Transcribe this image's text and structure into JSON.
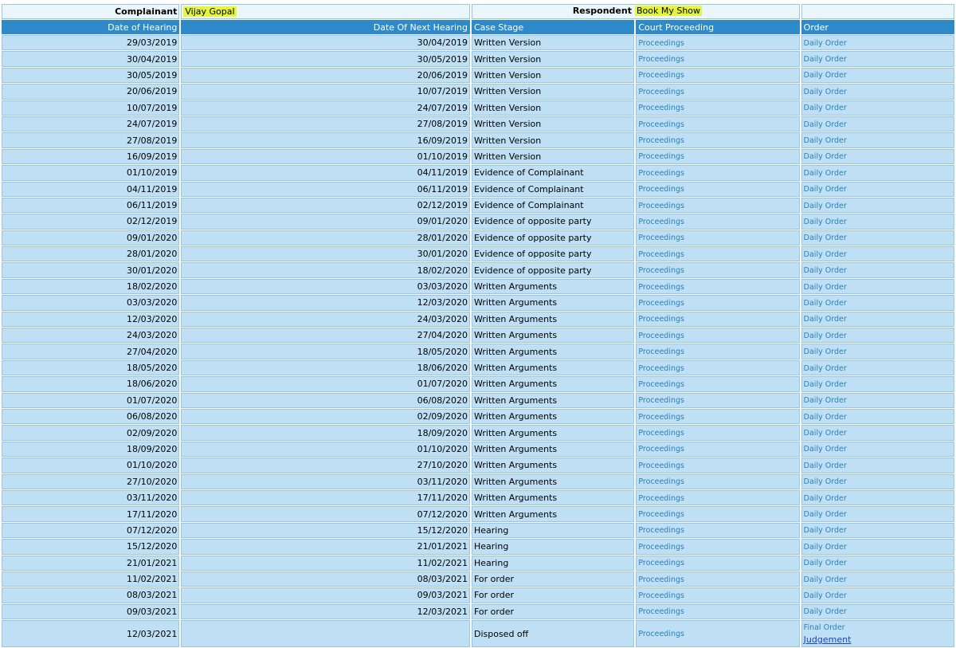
{
  "parties": {
    "complainant_label": "Complainant",
    "complainant_name": "Vijay Gopal",
    "respondent_label": "Respondent",
    "respondent_name": "Book My Show"
  },
  "columns": {
    "date_of_hearing": "Date of Hearing",
    "date_of_next_hearing": "Date Of Next Hearing",
    "case_stage": "Case Stage",
    "court_proceeding": "Court Proceeding",
    "order": "Order"
  },
  "link_labels": {
    "proceedings": "Proceedings",
    "daily_order": "Daily Order",
    "final_order": "Final Order",
    "judgement": "Judgement"
  },
  "rows": [
    {
      "hearing": "29/03/2019",
      "next": "30/04/2019",
      "stage": "Written Version"
    },
    {
      "hearing": "30/04/2019",
      "next": "30/05/2019",
      "stage": "Written Version"
    },
    {
      "hearing": "30/05/2019",
      "next": "20/06/2019",
      "stage": "Written Version"
    },
    {
      "hearing": "20/06/2019",
      "next": "10/07/2019",
      "stage": "Written Version"
    },
    {
      "hearing": "10/07/2019",
      "next": "24/07/2019",
      "stage": "Written Version"
    },
    {
      "hearing": "24/07/2019",
      "next": "27/08/2019",
      "stage": "Written Version"
    },
    {
      "hearing": "27/08/2019",
      "next": "16/09/2019",
      "stage": "Written Version"
    },
    {
      "hearing": "16/09/2019",
      "next": "01/10/2019",
      "stage": "Written Version"
    },
    {
      "hearing": "01/10/2019",
      "next": "04/11/2019",
      "stage": "Evidence of Complainant"
    },
    {
      "hearing": "04/11/2019",
      "next": "06/11/2019",
      "stage": "Evidence of Complainant"
    },
    {
      "hearing": "06/11/2019",
      "next": "02/12/2019",
      "stage": "Evidence of Complainant"
    },
    {
      "hearing": "02/12/2019",
      "next": "09/01/2020",
      "stage": "Evidence of opposite party"
    },
    {
      "hearing": "09/01/2020",
      "next": "28/01/2020",
      "stage": "Evidence of opposite party"
    },
    {
      "hearing": "28/01/2020",
      "next": "30/01/2020",
      "stage": "Evidence of opposite party"
    },
    {
      "hearing": "30/01/2020",
      "next": "18/02/2020",
      "stage": "Evidence of opposite party"
    },
    {
      "hearing": "18/02/2020",
      "next": "03/03/2020",
      "stage": "Written Arguments"
    },
    {
      "hearing": "03/03/2020",
      "next": "12/03/2020",
      "stage": "Written Arguments"
    },
    {
      "hearing": "12/03/2020",
      "next": "24/03/2020",
      "stage": "Written Arguments"
    },
    {
      "hearing": "24/03/2020",
      "next": "27/04/2020",
      "stage": "Written Arguments"
    },
    {
      "hearing": "27/04/2020",
      "next": "18/05/2020",
      "stage": "Written Arguments"
    },
    {
      "hearing": "18/05/2020",
      "next": "18/06/2020",
      "stage": "Written Arguments"
    },
    {
      "hearing": "18/06/2020",
      "next": "01/07/2020",
      "stage": "Written Arguments"
    },
    {
      "hearing": "01/07/2020",
      "next": "06/08/2020",
      "stage": "Written Arguments"
    },
    {
      "hearing": "06/08/2020",
      "next": "02/09/2020",
      "stage": "Written Arguments"
    },
    {
      "hearing": "02/09/2020",
      "next": "18/09/2020",
      "stage": "Written Arguments"
    },
    {
      "hearing": "18/09/2020",
      "next": "01/10/2020",
      "stage": "Written Arguments"
    },
    {
      "hearing": "01/10/2020",
      "next": "27/10/2020",
      "stage": "Written Arguments"
    },
    {
      "hearing": "27/10/2020",
      "next": "03/11/2020",
      "stage": "Written Arguments"
    },
    {
      "hearing": "03/11/2020",
      "next": "17/11/2020",
      "stage": "Written Arguments"
    },
    {
      "hearing": "17/11/2020",
      "next": "07/12/2020",
      "stage": "Written Arguments"
    },
    {
      "hearing": "07/12/2020",
      "next": "15/12/2020",
      "stage": "Hearing"
    },
    {
      "hearing": "15/12/2020",
      "next": "21/01/2021",
      "stage": "Hearing"
    },
    {
      "hearing": "21/01/2021",
      "next": "11/02/2021",
      "stage": "Hearing"
    },
    {
      "hearing": "11/02/2021",
      "next": "08/03/2021",
      "stage": "For order"
    },
    {
      "hearing": "08/03/2021",
      "next": "09/03/2021",
      "stage": "For order"
    },
    {
      "hearing": "09/03/2021",
      "next": "12/03/2021",
      "stage": "For order"
    }
  ],
  "final_row": {
    "hearing": "12/03/2021",
    "next": "",
    "stage": "Disposed off"
  },
  "colors": {
    "header_bg": "#2e8ac8",
    "cell_bg": "#bfe0f4",
    "highlight": "#e4f53a",
    "link": "#2a7fb5"
  }
}
